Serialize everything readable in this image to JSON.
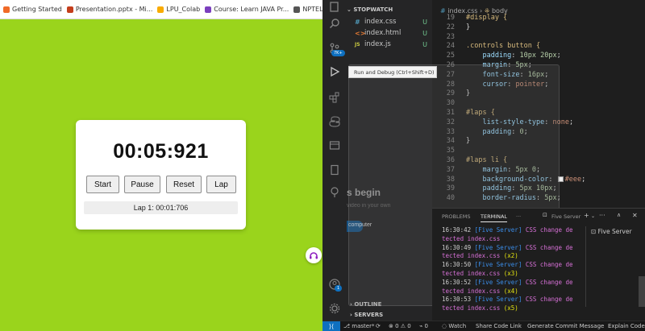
{
  "bookmarks": [
    {
      "label": "Getting Started",
      "color": "#f06a28"
    },
    {
      "label": "Presentation.pptx - Mi...",
      "color": "#c43e1c"
    },
    {
      "label": "LPU_Colab",
      "color": "#f9ab00"
    },
    {
      "label": "Course: Learn JAVA Pr...",
      "color": "#7b3fbe"
    },
    {
      "label": "NPTEL Cloud Computi...",
      "color": "#555555"
    }
  ],
  "bookmarks_more": "»",
  "stopwatch": {
    "display": "00:05:921",
    "buttons": {
      "start": "Start",
      "pause": "Pause",
      "reset": "Reset",
      "lap": "Lap"
    },
    "laps": [
      "Lap 1: 00:01:706"
    ]
  },
  "activity_badges": {
    "source_control": "7K+",
    "accounts": "1"
  },
  "explorer": {
    "section": "STOPWATCH",
    "files": [
      {
        "icon": "#",
        "name": "index.css",
        "status": "U",
        "icon_color": "#519aba"
      },
      {
        "icon": "<>",
        "name": "index.html",
        "status": "U",
        "icon_color": "#e37933"
      },
      {
        "icon": "JS",
        "name": "index.js",
        "status": "U",
        "icon_color": "#cbcb41"
      }
    ],
    "behind_begin": "s begin",
    "behind_sub": "video in your own",
    "behind_btn": "computer",
    "outline": "OUTLINE",
    "servers": "SERVERS"
  },
  "tooltip": "Run and Debug (Ctrl+Shift+D)",
  "editor": {
    "breadcrumb_file": "index.css",
    "breadcrumb_symbol": "body",
    "lines": [
      {
        "n": "19",
        "parts": [
          [
            "sel",
            "#display {"
          ]
        ]
      },
      {
        "n": "22",
        "parts": [
          [
            "punc",
            "}"
          ]
        ]
      },
      {
        "n": "23",
        "parts": []
      },
      {
        "n": "24",
        "parts": [
          [
            "sel",
            ".controls button {"
          ]
        ]
      },
      {
        "n": "25",
        "parts": [
          [
            "prop",
            "    padding"
          ],
          [
            "punc",
            ": "
          ],
          [
            "num",
            "10px 20px"
          ],
          [
            "punc",
            ";"
          ]
        ]
      },
      {
        "n": "26",
        "parts": [
          [
            "prop",
            "    margin"
          ],
          [
            "punc",
            ": "
          ],
          [
            "num",
            "5px"
          ],
          [
            "punc",
            ";"
          ]
        ]
      },
      {
        "n": "27",
        "parts": [
          [
            "prop",
            "    font-size"
          ],
          [
            "punc",
            ": "
          ],
          [
            "num",
            "16px"
          ],
          [
            "punc",
            ";"
          ]
        ]
      },
      {
        "n": "28",
        "parts": [
          [
            "prop",
            "    cursor"
          ],
          [
            "punc",
            ": "
          ],
          [
            "val",
            "pointer"
          ],
          [
            "punc",
            ";"
          ]
        ]
      },
      {
        "n": "29",
        "parts": [
          [
            "punc",
            "}"
          ]
        ]
      },
      {
        "n": "30",
        "parts": []
      },
      {
        "n": "31",
        "parts": [
          [
            "sel",
            "#laps {"
          ]
        ]
      },
      {
        "n": "32",
        "parts": [
          [
            "prop",
            "    list-style-type"
          ],
          [
            "punc",
            ": "
          ],
          [
            "val",
            "none"
          ],
          [
            "punc",
            ";"
          ]
        ]
      },
      {
        "n": "33",
        "parts": [
          [
            "prop",
            "    padding"
          ],
          [
            "punc",
            ": "
          ],
          [
            "num",
            "0"
          ],
          [
            "punc",
            ";"
          ]
        ]
      },
      {
        "n": "34",
        "parts": [
          [
            "punc",
            "}"
          ]
        ]
      },
      {
        "n": "35",
        "parts": []
      },
      {
        "n": "36",
        "parts": [
          [
            "sel",
            "#laps li {"
          ]
        ]
      },
      {
        "n": "37",
        "parts": [
          [
            "prop",
            "    margin"
          ],
          [
            "punc",
            ": "
          ],
          [
            "num",
            "5px 0"
          ],
          [
            "punc",
            ";"
          ]
        ]
      },
      {
        "n": "38",
        "parts": [
          [
            "prop",
            "    background-color"
          ],
          [
            "punc",
            ": "
          ],
          [
            "swatch",
            ""
          ],
          [
            "val",
            "#eee"
          ],
          [
            "punc",
            ";"
          ]
        ]
      },
      {
        "n": "39",
        "parts": [
          [
            "prop",
            "    padding"
          ],
          [
            "punc",
            ": "
          ],
          [
            "num",
            "5px 10px"
          ],
          [
            "punc",
            ";"
          ]
        ]
      },
      {
        "n": "40",
        "parts": [
          [
            "prop",
            "    border-radius"
          ],
          [
            "punc",
            ": "
          ],
          [
            "num",
            "5px"
          ],
          [
            "punc",
            ";"
          ]
        ]
      }
    ]
  },
  "panel": {
    "tabs": {
      "problems": "PROBLEMS",
      "terminal": "TERMINAL",
      "more": "···"
    },
    "terminal_name": "Five Server",
    "terminal_list": "Five Server",
    "lines": [
      {
        "time": "16:30:42",
        "srv": "[Five Server]",
        "msg": "CSS change de",
        "cont": "tected index.css",
        "count": ""
      },
      {
        "time": "16:30:49",
        "srv": "[Five Server]",
        "msg": "CSS change de",
        "cont": "tected index.css",
        "count": "(x2)"
      },
      {
        "time": "16:30:50",
        "srv": "[Five Server]",
        "msg": "CSS change de",
        "cont": "tected index.css",
        "count": "(x3)"
      },
      {
        "time": "16:30:52",
        "srv": "[Five Server]",
        "msg": "CSS change de",
        "cont": "tected index.css",
        "count": "(x4)"
      },
      {
        "time": "16:30:53",
        "srv": "[Five Server]",
        "msg": "CSS change de",
        "cont": "tected index.css",
        "count": "(x5)"
      }
    ]
  },
  "statusbar": {
    "branch": "master*",
    "errors": "0",
    "warnings": "0",
    "ports": "0",
    "watch": "Watch",
    "share": "Share Code Link",
    "commit": "Generate Commit Message",
    "explain": "Explain Code"
  }
}
